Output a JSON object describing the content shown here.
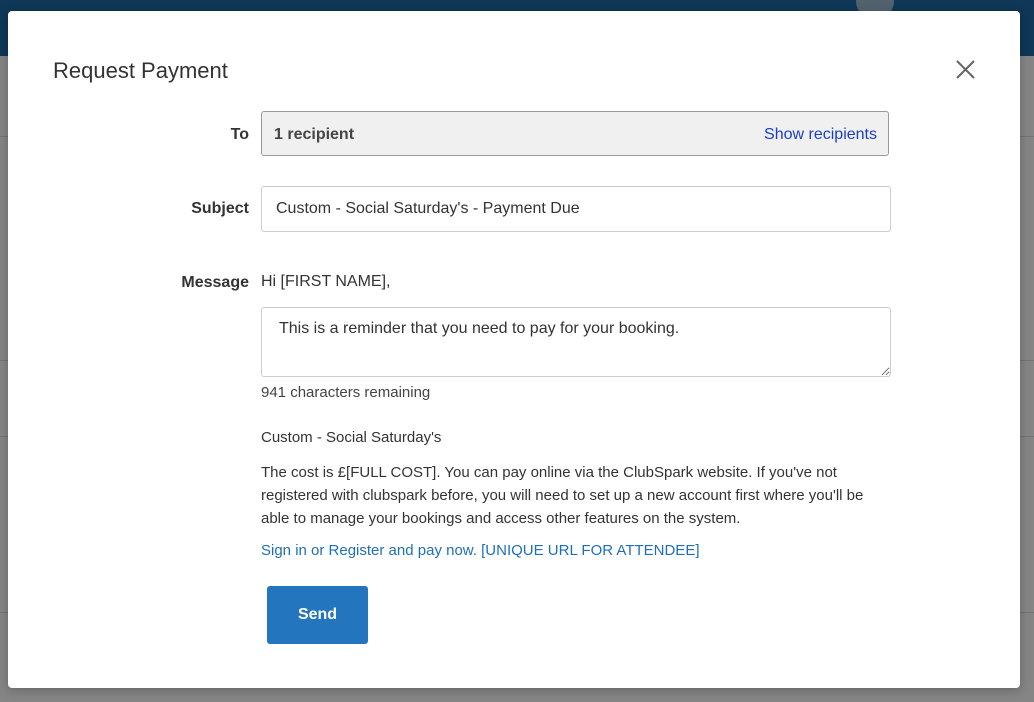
{
  "modal": {
    "title": "Request Payment",
    "to_label": "To",
    "to_value": "1 recipient",
    "show_recipients_label": "Show recipients",
    "subject_label": "Subject",
    "subject_value": "Custom - Social Saturday's - Payment Due",
    "message_label": "Message",
    "greeting": "Hi [FIRST NAME],",
    "message_value": "This is a reminder that you need to pay for your booking.",
    "chars_remaining": "941 characters remaining",
    "event_name": "Custom - Social Saturday's",
    "cost_text": "The cost is £[FULL COST]. You can pay online via the ClubSpark website. If you've not registered with clubspark before, you will need to set up a new account first where you'll be able to manage your bookings and access other features on the system.",
    "pay_link": "Sign in or Register and pay now. [UNIQUE URL FOR ATTENDEE]",
    "send_label": "Send"
  },
  "colors": {
    "primary_button": "#2376bd",
    "link": "#1f6fb8",
    "show_recipients_link": "#1a3ec8",
    "header_bar": "#1b5f96"
  },
  "icons": {
    "close": "close-icon"
  }
}
